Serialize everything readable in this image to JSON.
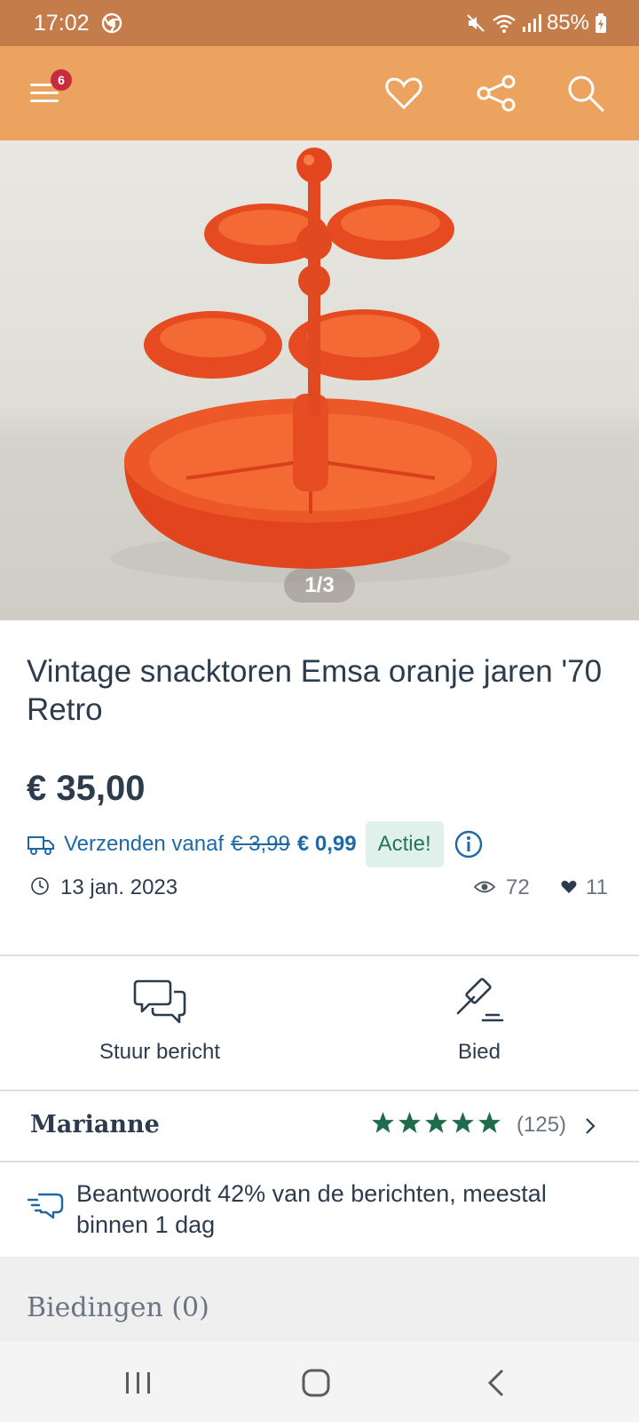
{
  "status": {
    "time": "17:02",
    "battery": "85%"
  },
  "header": {
    "menu_badge": "6",
    "icons": [
      "menu-icon",
      "heart-outline-icon",
      "share-icon",
      "search-icon"
    ]
  },
  "gallery": {
    "counter": "1/3"
  },
  "listing": {
    "title": "Vintage snacktoren Emsa oranje jaren '70 Retro",
    "price": "€ 35,00",
    "shipping_label": "Verzenden vanaf",
    "shipping_old_price": "€ 3,99",
    "shipping_new_price": "€ 0,99",
    "promo_badge": "Actie!",
    "date": "13 jan. 2023",
    "views": "72",
    "likes": "11"
  },
  "actions": {
    "message_label": "Stuur bericht",
    "bid_label": "Bied"
  },
  "seller": {
    "name": "Marianne",
    "rating_stars": 5,
    "rating_count": "(125)",
    "response_text": "Beantwoordt 42% van de berichten, meestal binnen 1 dag"
  },
  "offers": {
    "label": "Biedingen (0)"
  },
  "colors": {
    "status_bar": "#c47d4a",
    "app_bar": "#eca35f",
    "link_blue": "#1e69a5",
    "star_green": "#1f6b4c",
    "badge_red": "#c72b3c",
    "text_dark": "#2d3c4d"
  }
}
